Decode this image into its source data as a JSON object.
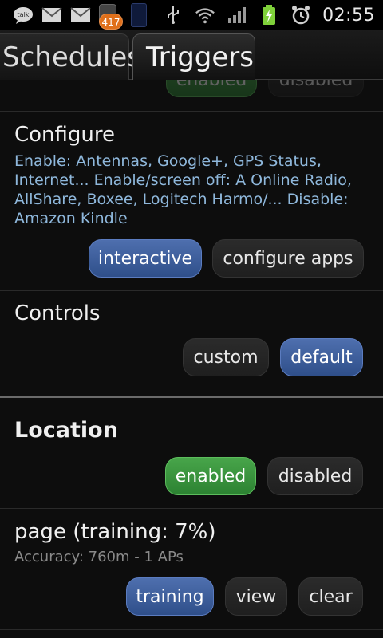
{
  "status_bar": {
    "talk_label": "talk",
    "badge_count": "417",
    "time": "02:55"
  },
  "tabs": [
    {
      "label": "Schedules"
    },
    {
      "label": "Triggers"
    }
  ],
  "top_partial": {
    "enabled_label": "enabled",
    "disabled_label": "disabled"
  },
  "configure": {
    "title": "Configure",
    "description": "Enable: Antennas, Google+, GPS Status, Internet... Enable/screen off: A Online Radio, AllShare, Boxee, Logitech Harmo/... Disable: Amazon Kindle",
    "interactive_label": "interactive",
    "configure_apps_label": "configure apps"
  },
  "controls": {
    "title": "Controls",
    "custom_label": "custom",
    "default_label": "default"
  },
  "location": {
    "title": "Location",
    "enabled_label": "enabled",
    "disabled_label": "disabled"
  },
  "page": {
    "title": "page (training: 7%)",
    "accuracy": "Accuracy: 760m - 1 APs",
    "training_label": "training",
    "view_label": "view",
    "clear_label": "clear"
  },
  "colors": {
    "accent_blue": "#3f5f9c",
    "accent_green": "#3b9a3e",
    "desc_text": "#8fb8dc"
  }
}
